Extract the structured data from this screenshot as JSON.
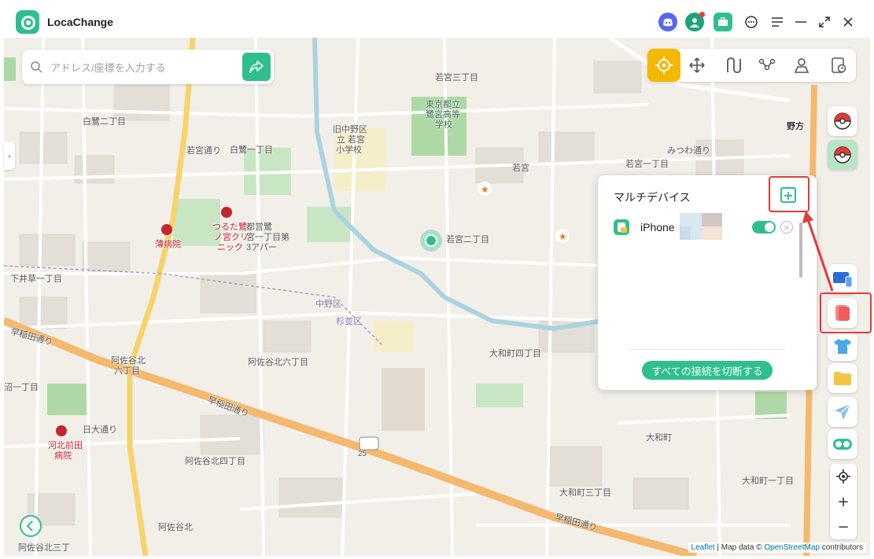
{
  "app": {
    "name": "LocaChange"
  },
  "search": {
    "placeholder": "アドレス/座標を入力する"
  },
  "panel": {
    "title": "マルチデバイス",
    "device_name": "iPhone",
    "disconnect_label": "すべての接続を切断する"
  },
  "map": {
    "labels": {
      "l1": "若宮三丁目",
      "l2": "東京都立",
      "l3": "鷺宮高等",
      "l4": "学校",
      "l5": "白鷺二丁目",
      "l6": "旧中野区",
      "l7": "立 若宮",
      "l8": "小学校",
      "l9": "若宮",
      "l10": "若宮二丁目",
      "l11": "白鷺一丁目",
      "l12": "若宮一丁目",
      "l13": "つるた鷺",
      "l14": "ノ宮クリ",
      "l15": "ニック",
      "l16": "薄病院",
      "l17": "下井草一丁目",
      "l18": "阿佐谷北六丁目",
      "l19": "阿佐谷北",
      "l20": "六丁目",
      "l21": "大和町四丁目",
      "l22": "早稲田通り",
      "l23": "阿佐谷北四丁目",
      "l24": "大和町",
      "l25": "大和町三丁目",
      "l26": "阿佐谷北",
      "l27": "大和町一丁目",
      "l28": "河北前田",
      "l29": "病院",
      "l30": "阿佐谷北三丁",
      "l31": "日大通り",
      "l32": "野方",
      "l33": "みつわ通り",
      "l34": "若宮通り",
      "l35": "沼一丁目",
      "l36": "25",
      "l37": "中野区",
      "l38": "杉並区",
      "l39": "都営鷺",
      "l40": "宮一丁目第",
      "l41": "3アパー",
      "l42": "早稲田通り",
      "l43": "阿佐谷北",
      "l44": "早稲田通り"
    }
  },
  "attribution": {
    "leaflet": "Leaflet",
    "sep": " | Map data © ",
    "osm": "OpenStreetMap",
    "tail": " contributors"
  },
  "colors": {
    "accent": "#2fbf8f",
    "highlight": "#e53935",
    "active_mode": "#f5b800"
  }
}
